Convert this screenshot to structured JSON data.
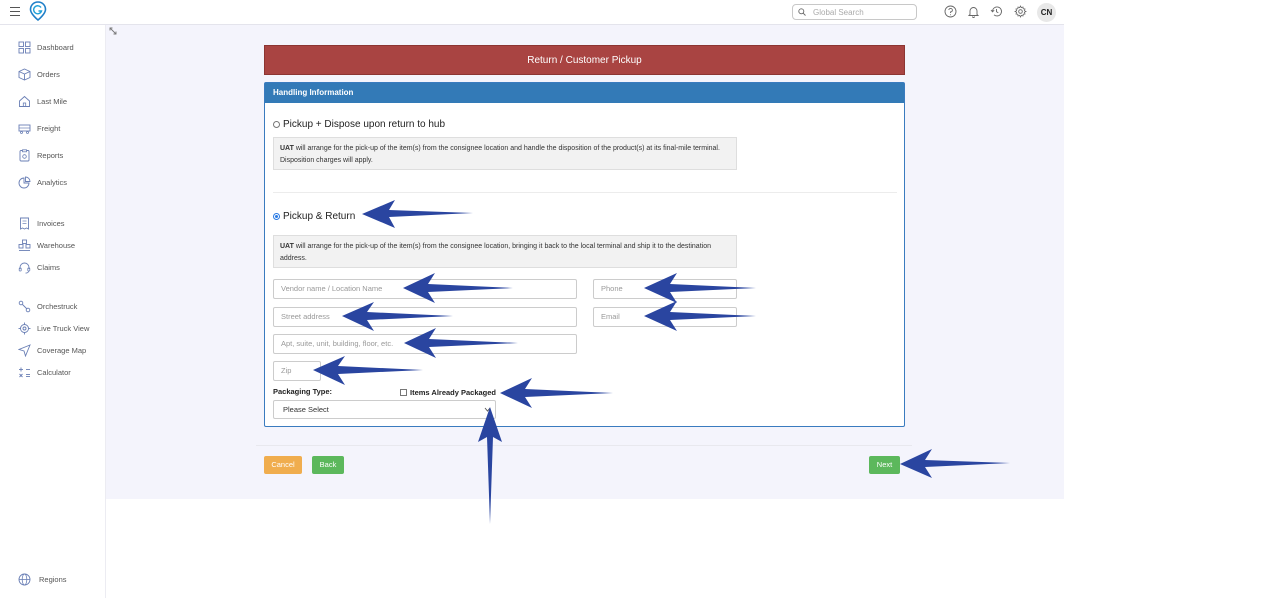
{
  "topbar": {
    "search_placeholder": "Global Search",
    "avatar_initials": "CN",
    "icons": [
      "help-icon",
      "bell-icon",
      "history-icon",
      "gear-icon"
    ]
  },
  "sidebar": {
    "items": [
      {
        "label": "Dashboard",
        "icon": "dashboard-icon"
      },
      {
        "label": "Orders",
        "icon": "box-icon"
      },
      {
        "label": "Last Mile",
        "icon": "house-icon"
      },
      {
        "label": "Freight",
        "icon": "truck-icon"
      },
      {
        "label": "Reports",
        "icon": "report-icon"
      },
      {
        "label": "Analytics",
        "icon": "analytics-icon"
      },
      {
        "label": "Invoices",
        "icon": "invoice-icon"
      },
      {
        "label": "Warehouse",
        "icon": "warehouse-icon"
      },
      {
        "label": "Claims",
        "icon": "headset-icon"
      },
      {
        "label": "Orchestruck",
        "icon": "orchestruck-icon"
      },
      {
        "label": "Live Truck View",
        "icon": "target-icon"
      },
      {
        "label": "Coverage Map",
        "icon": "navigation-icon"
      },
      {
        "label": "Calculator",
        "icon": "calculator-icon"
      }
    ],
    "footer_item": {
      "label": "Regions",
      "icon": "globe-icon"
    }
  },
  "page": {
    "title": "Return / Customer Pickup",
    "panel_title": "Handling Information",
    "option1": {
      "label": "Pickup + Dispose upon return to hub",
      "selected": false,
      "desc_bold": "UAT",
      "desc_text": " will arrange for the pick-up of the item(s) from the consignee location and handle the disposition of the product(s) at its final-mile terminal. Disposition charges will apply."
    },
    "option2": {
      "label": "Pickup & Return",
      "selected": true,
      "desc_bold": "UAT",
      "desc_text": " will arrange for the pick-up of the item(s) from the consignee location, bringing it back to the local terminal and ship it to the destination address."
    },
    "fields": {
      "vendor_placeholder": "Vendor name / Location Name",
      "phone_placeholder": "Phone",
      "street_placeholder": "Street address",
      "email_placeholder": "Email",
      "apt_placeholder": "Apt, suite, unit, building, floor, etc.",
      "zip_placeholder": "Zip"
    },
    "packaging_label": "Packaging Type:",
    "already_packaged_label": "Items Already Packaged",
    "packaging_select_value": "Please Select",
    "buttons": {
      "cancel": "Cancel",
      "back": "Back",
      "next": "Next"
    }
  },
  "colors": {
    "header_red": "#a94442",
    "panel_blue": "#337ab7",
    "cancel_orange": "#f0ad4e",
    "success_green": "#5cb85c",
    "annotation_arrow": "#2a45a0"
  }
}
